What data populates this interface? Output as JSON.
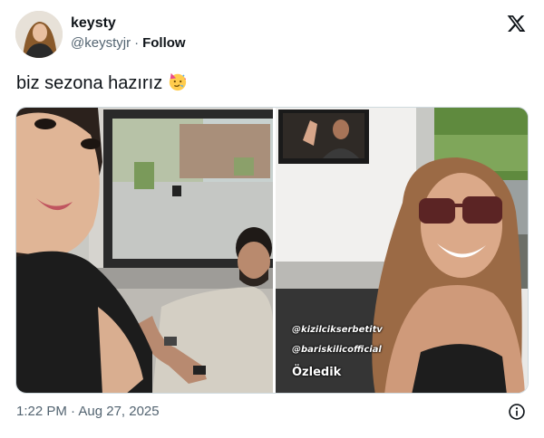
{
  "author": {
    "display_name": "keysty",
    "handle": "@keystyjr",
    "separator": "·",
    "follow_label": "Follow"
  },
  "tweet": {
    "text": "biz sezona hazırız",
    "emoji": "partying-face-emoji"
  },
  "media": {
    "right_photo_captions": [
      "@kizilcikserbetitv",
      "@bariskilicofficial",
      "Özledik"
    ]
  },
  "footer": {
    "timestamp": "1:22 PM · Aug 27, 2025"
  },
  "icons": {
    "brand": "x-logo-icon",
    "info": "info-icon"
  },
  "colors": {
    "text": "#0f1419",
    "secondary": "#536471",
    "border": "#cfd9de"
  }
}
